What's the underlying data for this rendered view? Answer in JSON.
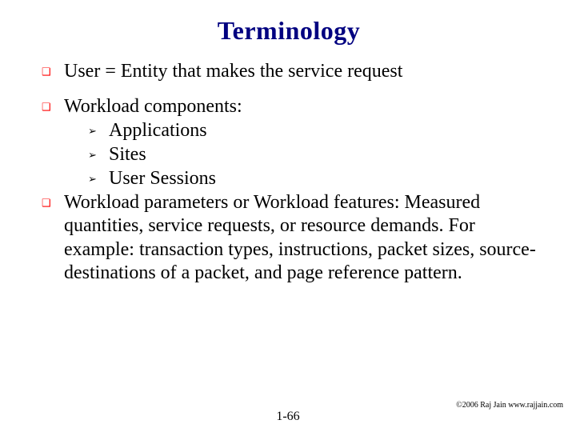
{
  "title": "Terminology",
  "items": [
    {
      "text": "User = Entity that makes the service request",
      "gapAfter": true
    },
    {
      "text": "Workload components:",
      "sub": [
        {
          "text": "Applications"
        },
        {
          "text": "Sites"
        },
        {
          "text": "User Sessions"
        }
      ]
    },
    {
      "text": "Workload parameters or Workload features: Measured quantities, service requests, or resource demands. For example: transaction types, instructions, packet sizes, source-destinations of a packet, and page reference pattern."
    }
  ],
  "pagenum": "1-66",
  "copyright": "©2006 Raj Jain www.rajjain.com",
  "glyphs": {
    "square": "❑",
    "triangle": "➢"
  }
}
